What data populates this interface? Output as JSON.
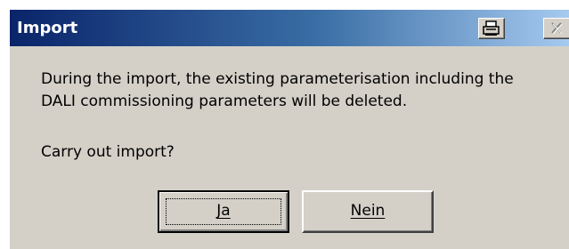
{
  "window": {
    "title": "Import",
    "title_icons": [
      "printer-icon",
      "close-icon"
    ],
    "colors": {
      "titlebar_start": "#0a246a",
      "titlebar_end": "#a6caf0",
      "face": "#d4d0c8"
    }
  },
  "message": {
    "line1": "During the import, the existing parameterisation including the",
    "line2": "DALI commissioning parameters will be deleted.",
    "question": "Carry out import?"
  },
  "buttons": {
    "yes_label": "Ja",
    "no_label": "Nein"
  }
}
